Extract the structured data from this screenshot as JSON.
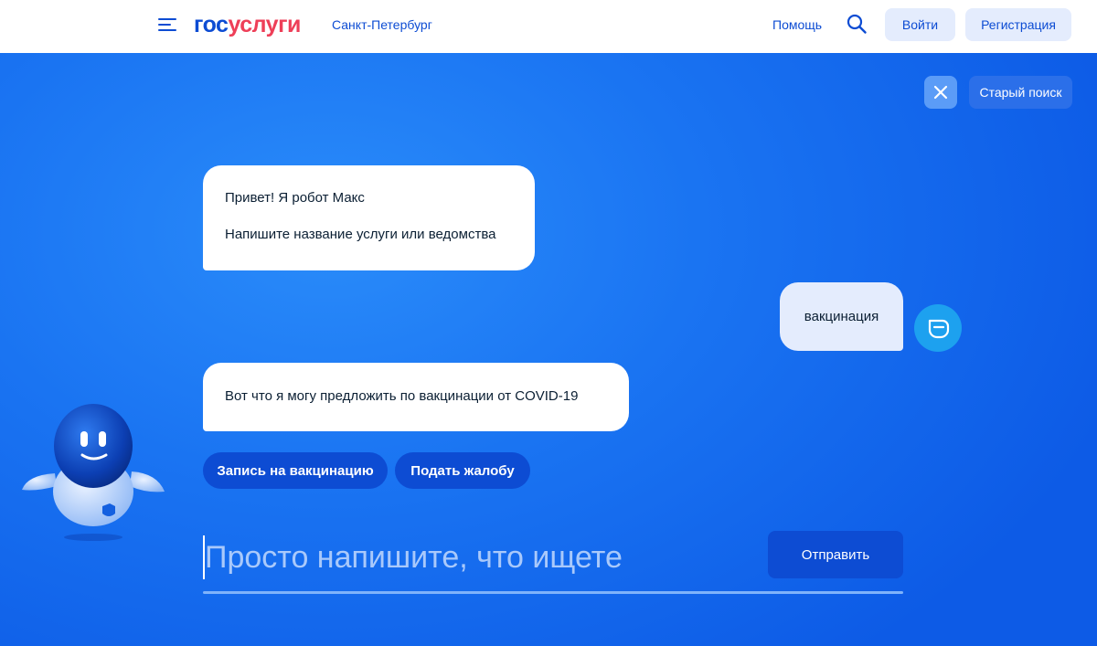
{
  "header": {
    "logo": {
      "part1": "гос",
      "part2": "услуги"
    },
    "region": "Санкт-Петербург",
    "help": "Помощь",
    "login": "Войти",
    "register": "Регистрация"
  },
  "assistant": {
    "old_search": "Старый поиск",
    "messages": [
      {
        "from": "bot",
        "lines": [
          "Привет! Я робот Макс",
          "Напишите название услуги или ведомства"
        ]
      },
      {
        "from": "user",
        "text": "вакцинация"
      },
      {
        "from": "bot",
        "lines": [
          "Вот что я могу предложить по вакцинации от COVID-19"
        ]
      }
    ],
    "options": [
      "Запись на вакцинацию",
      "Подать жалобу"
    ],
    "input": {
      "value": "",
      "placeholder": "Просто напишите, что ищете"
    },
    "send": "Отправить"
  },
  "colors": {
    "brand_blue": "#0d4cd3",
    "brand_red": "#ee3f58",
    "hero_blue": "#1a74f2",
    "light_button": "#e4ecfd"
  },
  "icons": [
    "menu-icon",
    "search-icon",
    "close-icon",
    "user-avatar-icon",
    "robot-mascot"
  ]
}
